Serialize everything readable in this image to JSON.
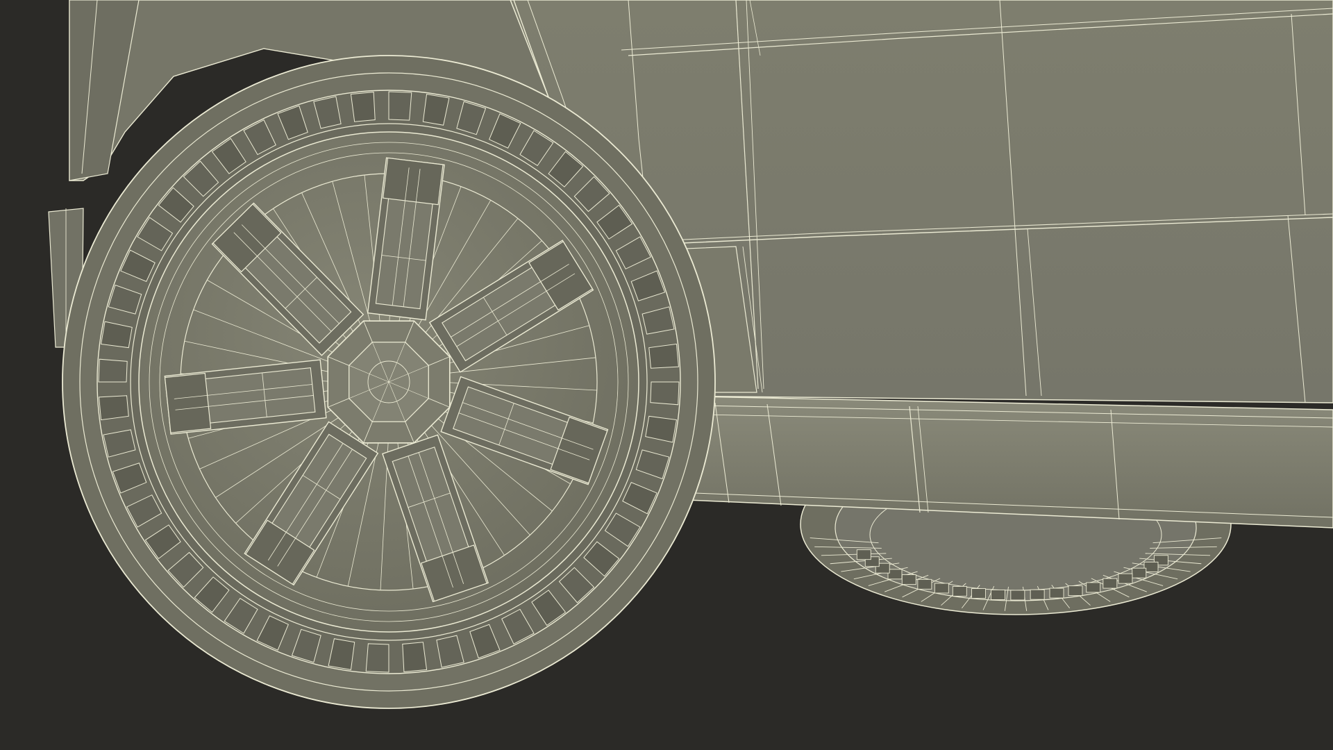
{
  "scene": {
    "subject": "wireframe-render-vehicle-wheels",
    "colors": {
      "background": "#2b2a27",
      "surface_light": "#8a8a7a",
      "surface_mid": "#7b7b6c",
      "surface_dark": "#666658",
      "surface_shadow": "#55554a",
      "wire": "#ecebd4",
      "wire_dim": "#d8d7bd"
    }
  }
}
